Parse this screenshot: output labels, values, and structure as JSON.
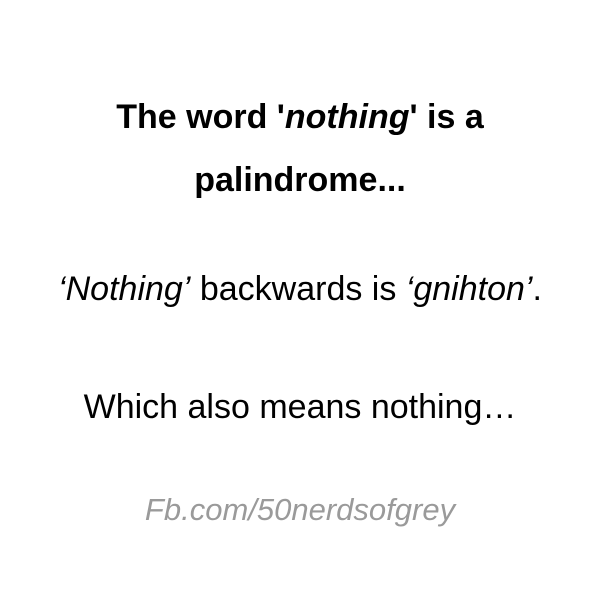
{
  "headline": {
    "line1_before": "The word '",
    "line1_italic": "nothing",
    "line1_after": "' is a",
    "line2": "palindrome..."
  },
  "backwards": {
    "word_italic": "‘Nothing’",
    "middle": " backwards is ",
    "reversed_italic": "‘gnihton’",
    "end": "."
  },
  "meaning": {
    "text": "Which also means nothing…"
  },
  "credit": {
    "text": "Fb.com/50nerdsofgrey"
  }
}
